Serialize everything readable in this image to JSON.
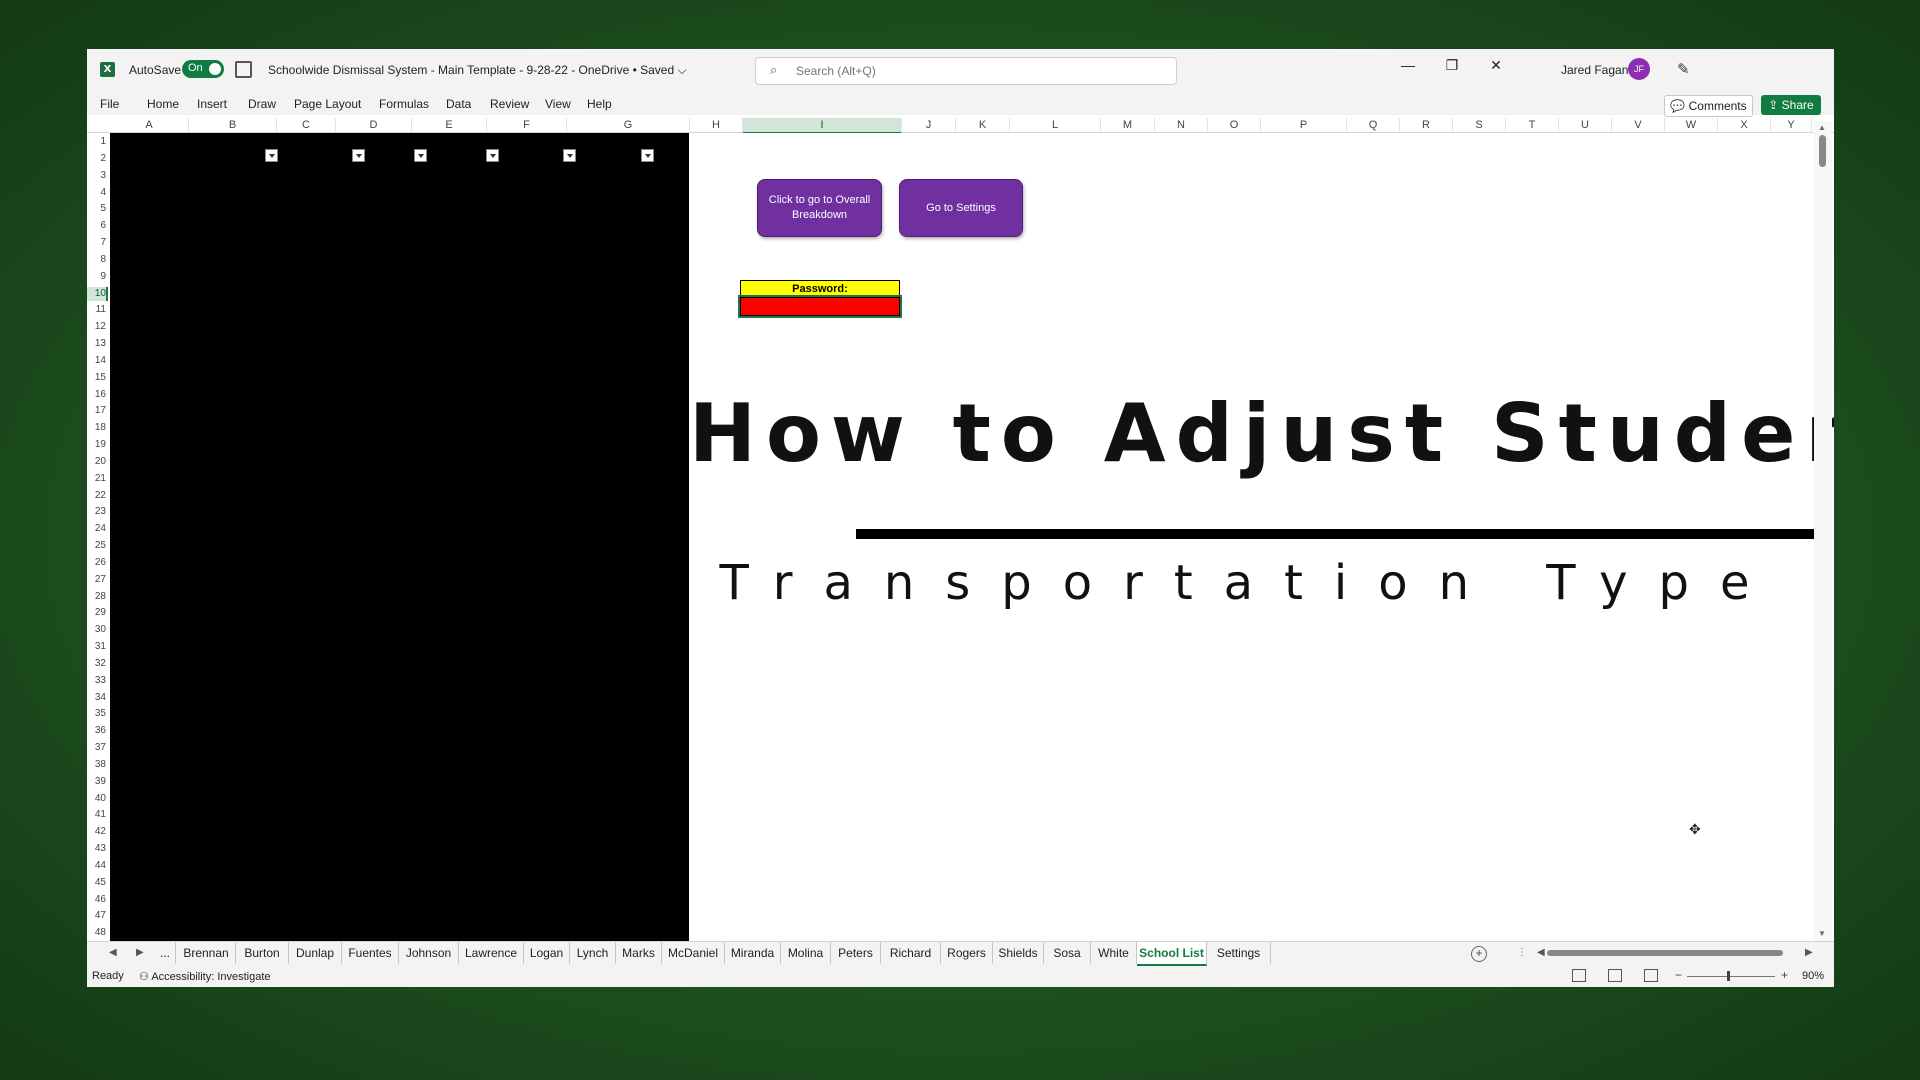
{
  "app": {
    "autosave_label": "AutoSave",
    "autosave_state": "On",
    "document_title": "Schoolwide Dismissal System - Main Template - 9-28-22 - OneDrive • Saved ⌵",
    "search_placeholder": "Search (Alt+Q)",
    "user_name": "Jared Fagan",
    "user_initials": "JF",
    "accent_color": "#107c41"
  },
  "menu": [
    "File",
    "Home",
    "Insert",
    "Draw",
    "Page Layout",
    "Formulas",
    "Data",
    "Review",
    "View",
    "Help"
  ],
  "actions": {
    "comments": "Comments",
    "share": "Share"
  },
  "columns": [
    "A",
    "B",
    "C",
    "D",
    "E",
    "F",
    "G",
    "H",
    "I",
    "J",
    "K",
    "L",
    "M",
    "N",
    "O",
    "P",
    "Q",
    "R",
    "S",
    "T",
    "U",
    "V",
    "W",
    "X",
    "Y"
  ],
  "selected_column": "I",
  "selected_row": "10",
  "rows": [
    "1",
    "2",
    "3",
    "4",
    "5",
    "6",
    "7",
    "8",
    "9",
    "10",
    "11",
    "12",
    "13",
    "14",
    "15",
    "16",
    "17",
    "18",
    "19",
    "20",
    "21",
    "22",
    "23",
    "24",
    "25",
    "26",
    "27",
    "28",
    "29",
    "30",
    "31",
    "32",
    "33",
    "34",
    "35",
    "36",
    "37",
    "38",
    "39",
    "40",
    "41",
    "42",
    "43",
    "44",
    "45",
    "46",
    "47",
    "48"
  ],
  "sheet": {
    "button_overall": "Click to go to Overall Breakdown",
    "button_settings": "Go to Settings",
    "password_label": "Password:",
    "heading": "How to Adjust Student",
    "subheading": "Transportation Type"
  },
  "tabs": {
    "ellipsis": "...",
    "items": [
      "Brennan",
      "Burton",
      "Dunlap",
      "Fuentes",
      "Johnson",
      "Lawrence",
      "Logan",
      "Lynch",
      "Marks",
      "McDaniel",
      "Miranda",
      "Molina",
      "Peters",
      "Richard",
      "Rogers",
      "Shields",
      "Sosa",
      "White",
      "School List",
      "Settings"
    ],
    "active": "School List"
  },
  "status": {
    "ready": "Ready",
    "accessibility": "Accessibility: Investigate",
    "zoom": "90%"
  }
}
